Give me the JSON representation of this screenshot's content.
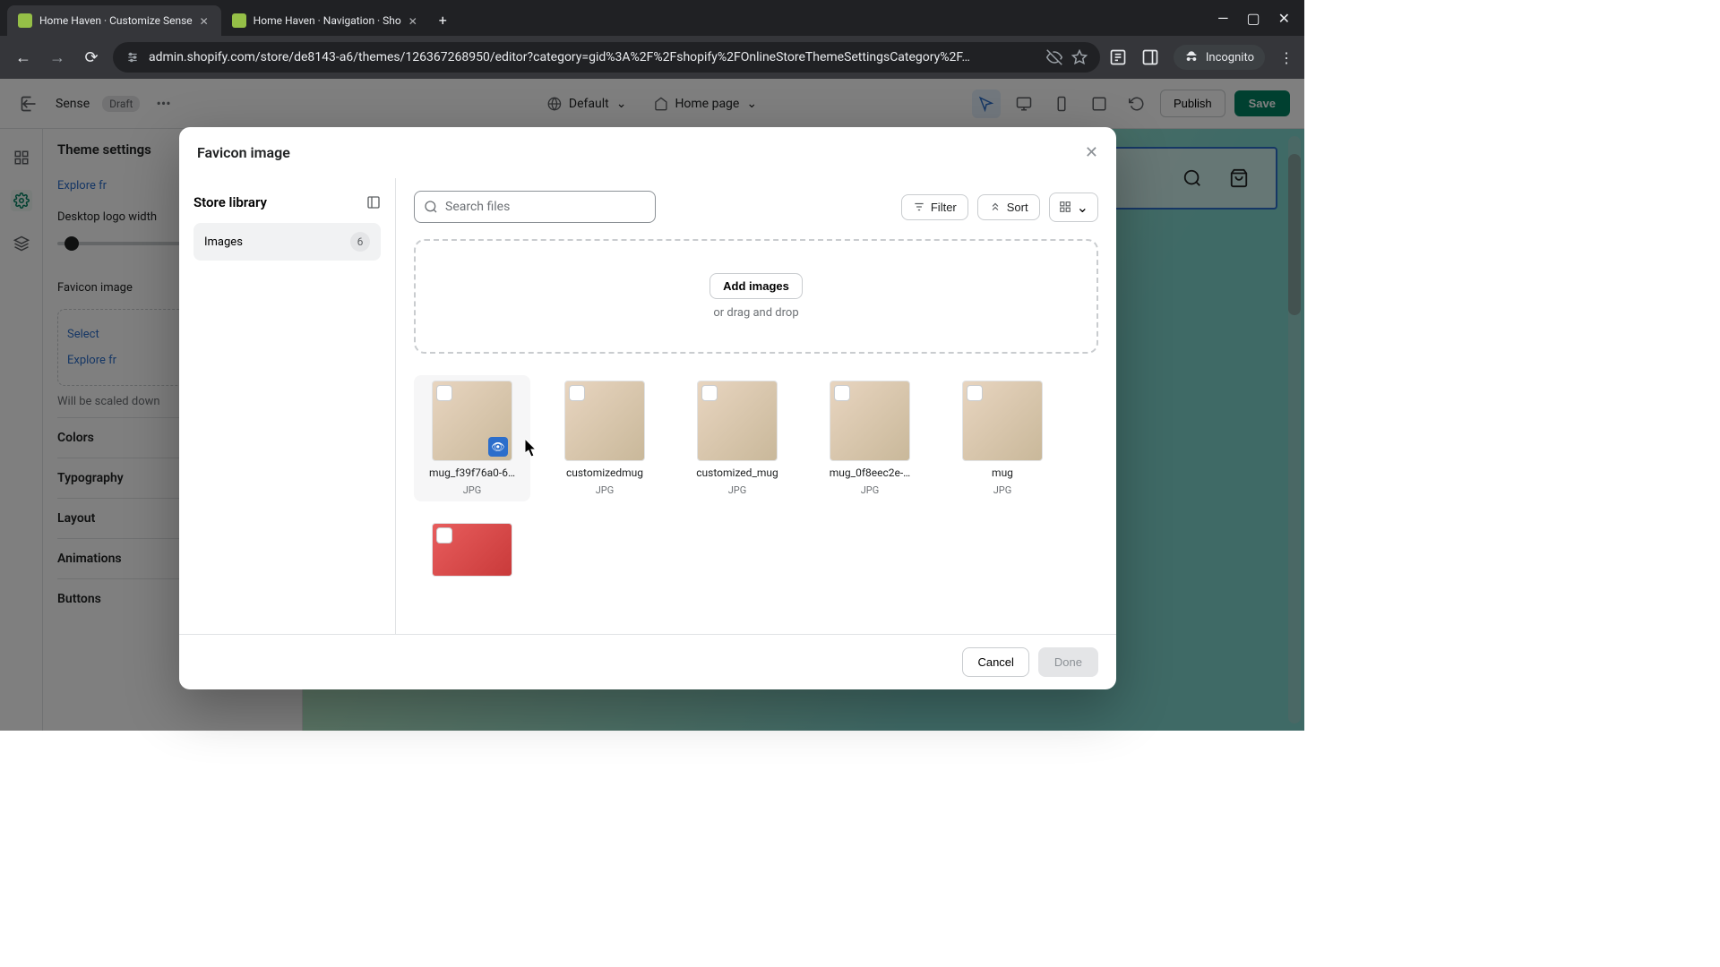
{
  "browser": {
    "tabs": [
      {
        "title": "Home Haven · Customize Sense"
      },
      {
        "title": "Home Haven · Navigation · Sho"
      }
    ],
    "url": "admin.shopify.com/store/de8143-a6/themes/126367268950/editor?category=gid%3A%2F%2Fshopify%2FOnlineStoreThemeSettingsCategory%2F…",
    "incognito": "Incognito"
  },
  "editor": {
    "theme": "Sense",
    "status": "Draft",
    "viewport": "Default",
    "page": "Home page",
    "publish": "Publish",
    "save": "Save"
  },
  "panel": {
    "title": "Theme settings",
    "explore1": "Explore fr",
    "logo_width": "Desktop logo width",
    "favicon": "Favicon image",
    "select": "Select",
    "explore2": "Explore fr",
    "scaled": "Will be scaled down",
    "sections": [
      "Colors",
      "Typography",
      "Layout",
      "Animations",
      "Buttons"
    ]
  },
  "modal": {
    "title": "Favicon image",
    "store_library": "Store library",
    "images": "Images",
    "count": "6",
    "search_placeholder": "Search files",
    "filter": "Filter",
    "sort": "Sort",
    "add_images": "Add images",
    "drag_hint": "or drag and drop",
    "files": [
      {
        "name": "mug_f39f76a0-6…",
        "ext": "JPG"
      },
      {
        "name": "customizedmug",
        "ext": "JPG"
      },
      {
        "name": "customized_mug",
        "ext": "JPG"
      },
      {
        "name": "mug_0f8eec2e-…",
        "ext": "JPG"
      },
      {
        "name": "mug",
        "ext": "JPG"
      },
      {
        "name": "",
        "ext": ""
      }
    ],
    "cancel": "Cancel",
    "done": "Done"
  }
}
